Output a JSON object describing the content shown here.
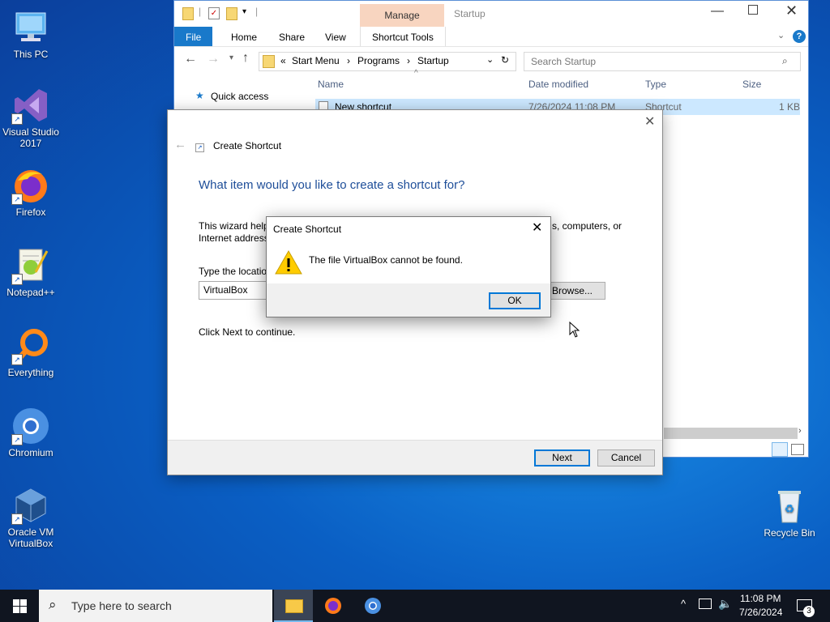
{
  "desktop": {
    "icons": [
      {
        "label": "This PC"
      },
      {
        "label": "Visual Studio 2017"
      },
      {
        "label": "Firefox"
      },
      {
        "label": "Notepad++"
      },
      {
        "label": "Everything"
      },
      {
        "label": "Chromium"
      },
      {
        "label": "Oracle VM VirtualBox"
      },
      {
        "label": "Recycle Bin"
      }
    ]
  },
  "explorer": {
    "title": "Startup",
    "manage_tab": "Manage",
    "tabs": [
      "File",
      "Home",
      "Share",
      "View",
      "Shortcut Tools"
    ],
    "breadcrumb": {
      "prefix": "«",
      "items": [
        "Start Menu",
        "Programs",
        "Startup"
      ]
    },
    "search_placeholder": "Search Startup",
    "nav": {
      "quick_access": "Quick access"
    },
    "columns": {
      "name": "Name",
      "date": "Date modified",
      "type": "Type",
      "size": "Size"
    },
    "rows": [
      {
        "name": "New shortcut",
        "date": "7/26/2024 11:08 PM",
        "type": "Shortcut",
        "size": "1 KB"
      }
    ]
  },
  "wizard": {
    "title": "Create Shortcut",
    "heading": "What item would you like to create a shortcut for?",
    "desc_line1_a": "This wizard help",
    "desc_line1_b": "s, computers, or",
    "desc_line2": "Internet address",
    "location_label": "Type the locatio",
    "location_value": "VirtualBox",
    "browse_label": "Browse...",
    "continue_text": "Click Next to continue.",
    "next_label": "Next",
    "cancel_label": "Cancel"
  },
  "error_dialog": {
    "title": "Create Shortcut",
    "message": "The file VirtualBox cannot be found.",
    "ok_label": "OK"
  },
  "taskbar": {
    "search_placeholder": "Type here to search",
    "time": "11:08 PM",
    "date": "7/26/2024",
    "notification_count": "3"
  },
  "colors": {
    "accent": "#1979ca",
    "selection": "#cce8ff",
    "manage_tab": "#f8d5c0",
    "heading": "#1e4e99"
  }
}
